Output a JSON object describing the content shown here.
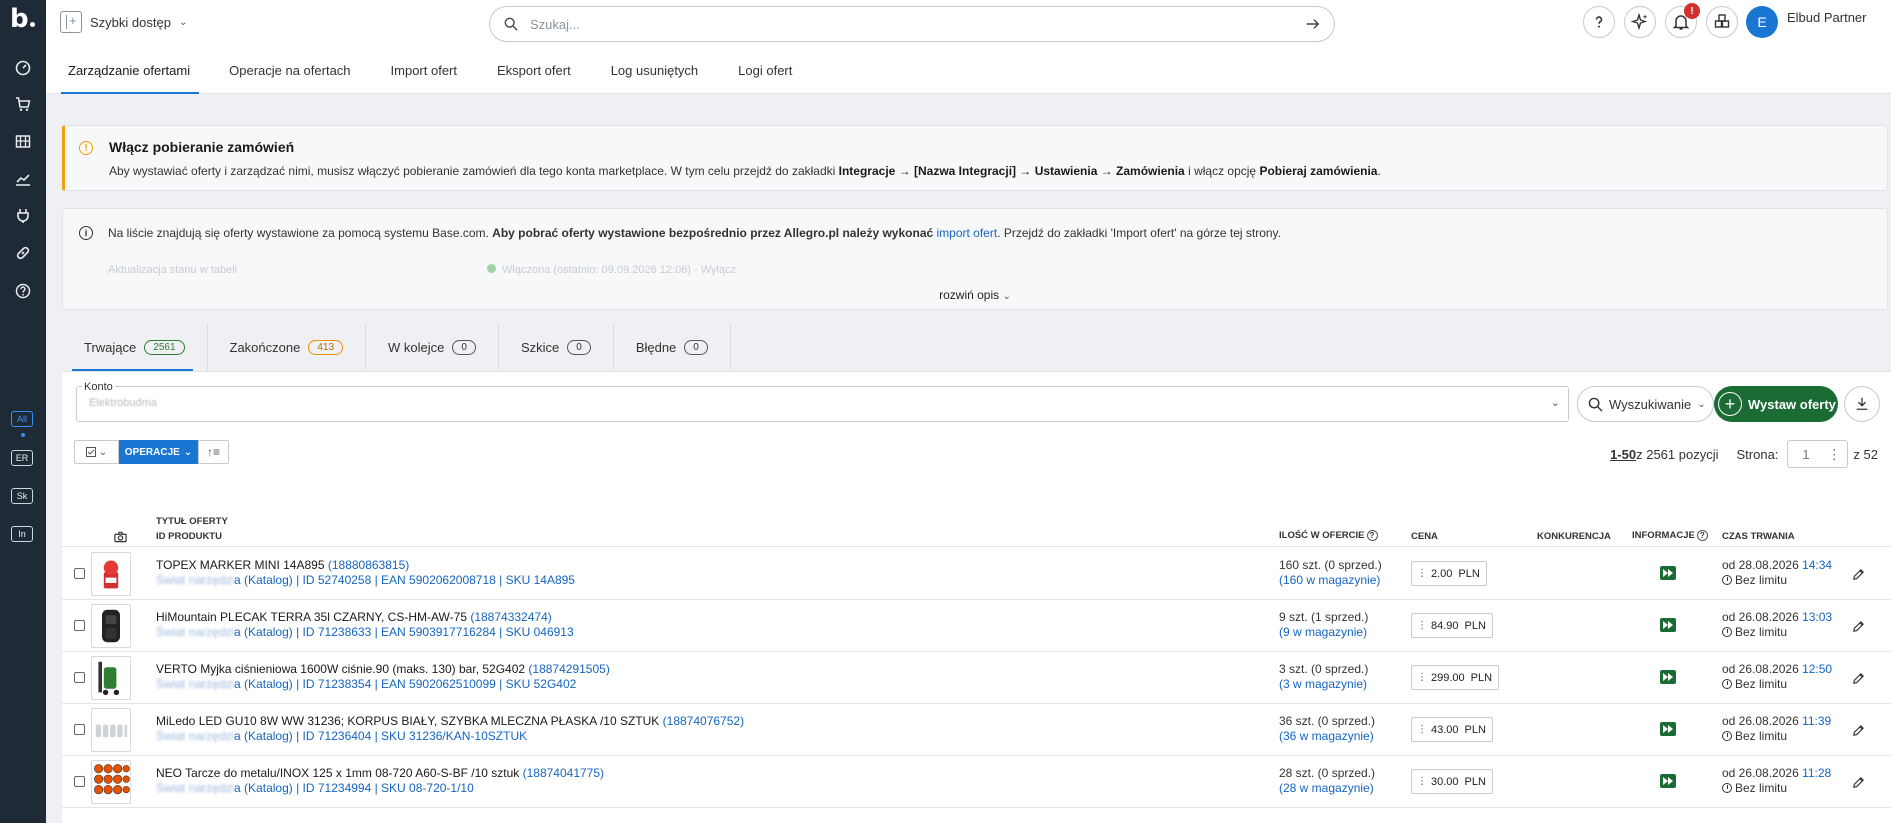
{
  "sidebar": {
    "logo": "b",
    "badges": [
      "All",
      "ER",
      "Sk",
      "In"
    ]
  },
  "header": {
    "quick_access": "Szybki dostęp",
    "search_placeholder": "Szukaj...",
    "notification_count": "!",
    "user_initial": "E",
    "user_name": "Elbud Partner"
  },
  "tabs": [
    "Zarządzanie ofertami",
    "Operacje na ofertach",
    "Import ofert",
    "Eksport ofert",
    "Log usuniętych",
    "Logi ofert"
  ],
  "warning": {
    "title": "Włącz pobieranie zamówień",
    "text_pre": "Aby wystawiać oferty i zarządzać nimi, musisz włączyć pobieranie zamówień dla tego konta marketplace. W tym celu przejdź do zakładki ",
    "b1": "Integracje → [Nazwa Integracji] → Ustawienia → Zamówienia",
    "text_mid": " i włącz opcję ",
    "b2": "Pobieraj zamówienia",
    "text_end": "."
  },
  "info": {
    "text_pre": "Na liście znajdują się oferty wystawione za pomocą systemu Base.com. ",
    "bold": "Aby pobrać oferty wystawione bezpośrednio przez Allegro.pl należy wykonać ",
    "link": "import ofert",
    "text_end": ". Przejdź do zakładki 'Import ofert' na górze tej strony.",
    "faded_left": "Aktualizacja stanu w tabeli",
    "faded_right": "Włączona (ostatnio: 09.09.2026 12:06) - ",
    "faded_link": "Wyłącz",
    "expand": "rozwiń opis"
  },
  "status_tabs": [
    {
      "label": "Trwające",
      "count": "2561"
    },
    {
      "label": "Zakończone",
      "count": "413"
    },
    {
      "label": "W kolejce",
      "count": "0"
    },
    {
      "label": "Szkice",
      "count": "0"
    },
    {
      "label": "Błędne",
      "count": "0"
    }
  ],
  "panel": {
    "account_label": "Konto",
    "account_value": "Elektrobudma",
    "search_btn": "Wyszukiwanie",
    "add_btn": "Wystaw oferty",
    "ops_btn": "OPERACJE",
    "range": "1-50",
    "range_rest": " z 2561 pozycji",
    "page_label": "Strona:",
    "page_value": "1",
    "page_total": "z 52"
  },
  "columns": {
    "title": "TYTUŁ OFERTY",
    "product_id": "ID PRODUKTU",
    "qty": "ILOŚĆ W OFERCIE",
    "price": "CENA",
    "competition": "KONKURENCJA",
    "info": "INFORMACJE",
    "duration": "CZAS TRWANIA"
  },
  "rows": [
    {
      "title": "TOPEX MARKER MINI 14A895 ",
      "offer_id": "(18880863815)",
      "cat_blur": "Świat narzędzi",
      "cat": "a (Katalog)",
      "ids": " | ID 52740258 | EAN 5902062008718 | SKU 14A895",
      "qty": "160 szt. (0 sprzed.)",
      "stock": "(160 w magazynie)",
      "price": "2.00",
      "currency": "PLN",
      "date": "od 28.08.2026 ",
      "time": "14:34",
      "limit": "Bez limitu"
    },
    {
      "title": "HiMountain PLECAK TERRA 35l CZARNY, CS-HM-AW-75 ",
      "offer_id": "(18874332474)",
      "cat_blur": "Świat narzędzi",
      "cat": "a (Katalog)",
      "ids": " | ID 71238633 | EAN 5903917716284 | SKU 046913",
      "qty": "9 szt. (1 sprzed.)",
      "stock": "(9 w magazynie)",
      "price": "84.90",
      "currency": "PLN",
      "date": "od 26.08.2026 ",
      "time": "13:03",
      "limit": "Bez limitu"
    },
    {
      "title": "VERTO Myjka ciśnieniowa 1600W ciśnie.90 (maks. 130) bar, 52G402 ",
      "offer_id": "(18874291505)",
      "cat_blur": "Świat narzędzi",
      "cat": "a (Katalog)",
      "ids": " | ID 71238354 | EAN 5902062510099 | SKU 52G402",
      "qty": "3 szt. (0 sprzed.)",
      "stock": "(3 w magazynie)",
      "price": "299.00",
      "currency": "PLN",
      "date": "od 26.08.2026 ",
      "time": "12:50",
      "limit": "Bez limitu"
    },
    {
      "title": "MiLedo LED GU10 8W WW 31236; KORPUS BIAŁY, SZYBKA MLECZNA PŁASKA /10 SZTUK ",
      "offer_id": "(18874076752)",
      "cat_blur": "Świat narzędzi",
      "cat": "a (Katalog)",
      "ids": " | ID 71236404 | SKU 31236/KAN-10SZTUK",
      "qty": "36 szt. (0 sprzed.)",
      "stock": "(36 w magazynie)",
      "price": "43.00",
      "currency": "PLN",
      "date": "od 26.08.2026 ",
      "time": "11:39",
      "limit": "Bez limitu"
    },
    {
      "title": "NEO Tarcze do metalu/INOX 125 x 1mm 08-720 A60-S-BF /10 sztuk ",
      "offer_id": "(18874041775)",
      "cat_blur": "Świat narzędzi",
      "cat": "a (Katalog)",
      "ids": " | ID 71234994 | SKU 08-720-1/10",
      "qty": "28 szt. (0 sprzed.)",
      "stock": "(28 w magazynie)",
      "price": "30.00",
      "currency": "PLN",
      "date": "od 26.08.2026 ",
      "time": "11:28",
      "limit": "Bez limitu"
    }
  ]
}
